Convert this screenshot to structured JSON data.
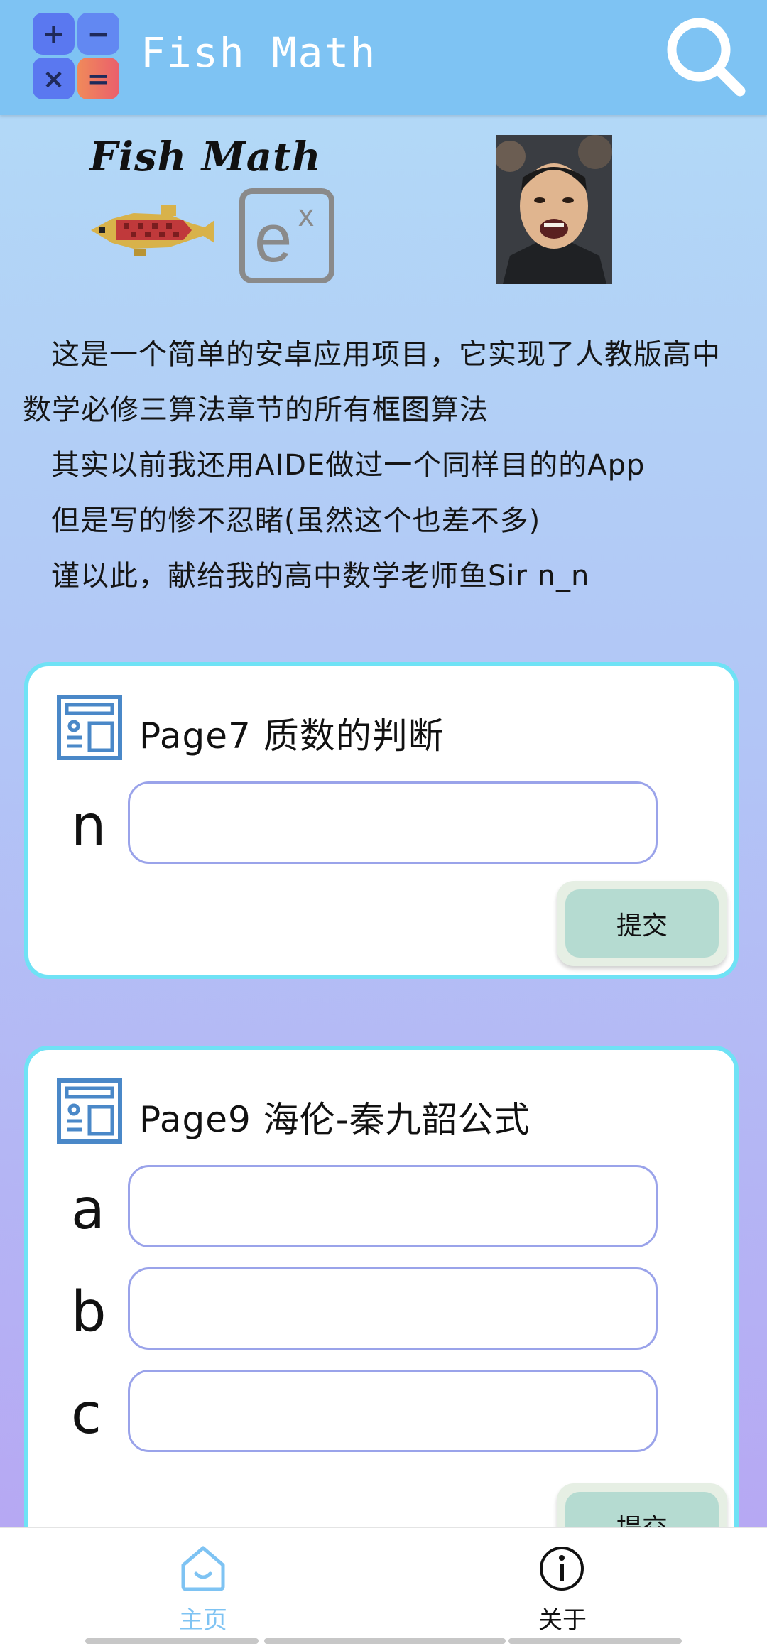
{
  "app": {
    "title": "Fish Math"
  },
  "logo": {
    "tiles": [
      "+",
      "−",
      "×",
      "="
    ],
    "colors": [
      "#5a78f0",
      "#6288f2",
      "#5a78f0",
      "#ea6b67"
    ]
  },
  "banner": {
    "brand_text": "Fish Math",
    "ex_icon_text": "e",
    "ex_icon_sup": "x"
  },
  "intro": {
    "lines": [
      "这是一个简单的安卓应用项目，它实现了人教版高中数学必修三算法章节的所有框图算法",
      "其实以前我还用AIDE做过一个同样目的的App",
      "但是写的惨不忍睹(虽然这个也差不多)",
      "谨以此，献给我的高中数学老师鱼Sir n_n"
    ]
  },
  "cards": [
    {
      "title": "Page7  质数的判断",
      "fields": [
        {
          "label": "n",
          "value": "",
          "placeholder": ""
        }
      ],
      "submit_label": "提交"
    },
    {
      "title": "Page9  海伦-秦九韶公式",
      "fields": [
        {
          "label": "a",
          "value": "",
          "placeholder": ""
        },
        {
          "label": "b",
          "value": "",
          "placeholder": ""
        },
        {
          "label": "c",
          "value": "",
          "placeholder": ""
        }
      ],
      "submit_label": "提交"
    }
  ],
  "bottom_nav": {
    "items": [
      {
        "label": "主页",
        "icon": "home-icon",
        "active": true
      },
      {
        "label": "关于",
        "icon": "info-icon",
        "active": false
      }
    ],
    "active_color": "#7ec3f3"
  }
}
